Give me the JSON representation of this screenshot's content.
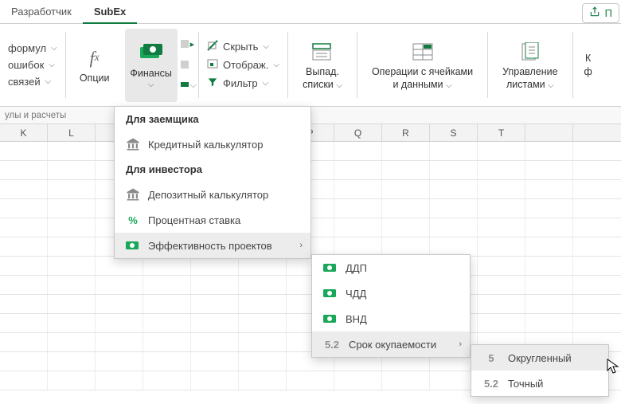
{
  "tabs": {
    "developer": "Разработчик",
    "subex": "SubEx",
    "share": "П"
  },
  "ribbon": {
    "leftSmall": [
      "формул",
      "ошибок",
      "связей"
    ],
    "options": "Опции",
    "finances": "Финансы",
    "mid": [
      "Скрыть",
      "Отображ.",
      "Фильтр"
    ],
    "dropdown": {
      "label1": "Выпад.",
      "label2": "списки"
    },
    "cells": {
      "label1": "Операции с ячейками",
      "label2": "и данными"
    },
    "sheets": {
      "label1": "Управление",
      "label2": "листами"
    },
    "last": {
      "label1": "К",
      "label2": "ф"
    }
  },
  "subbar": "улы и расчеты",
  "columns": [
    "K",
    "L",
    "",
    "",
    "",
    "",
    "P",
    "Q",
    "R",
    "S",
    "T",
    ""
  ],
  "menu1": {
    "section1_title": "Для заемщика",
    "item1": "Кредитный калькулятор",
    "section2_title": "Для инвестора",
    "item2": "Депозитный калькулятор",
    "item3": "Процентная ставка",
    "item4": "Эффективность проектов"
  },
  "menu2": {
    "item1": "ДДП",
    "item2": "ЧДД",
    "item3": "ВНД",
    "item4": "Срок окупаемости",
    "item4_icon": "5.2"
  },
  "menu3": {
    "item1": "Округленный",
    "item1_icon": "5",
    "item2": "Точный",
    "item2_icon": "5.2"
  }
}
